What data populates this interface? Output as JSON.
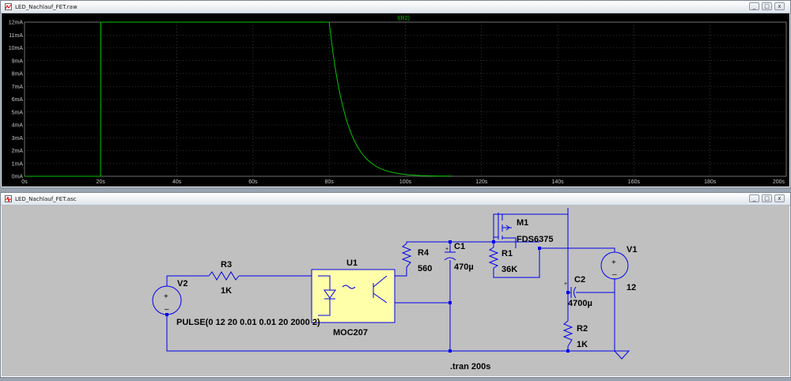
{
  "plot_window": {
    "title": "LED_Nachlauf_FET.raw",
    "trace_name": "I(R2)",
    "trace_color": "#00c400",
    "y_ticks": [
      "12mA",
      "11mA",
      "10mA",
      "9mA",
      "8mA",
      "7mA",
      "6mA",
      "5mA",
      "4mA",
      "3mA",
      "2mA",
      "1mA",
      "0mA"
    ],
    "x_ticks": [
      "0s",
      "20s",
      "40s",
      "60s",
      "80s",
      "100s",
      "120s",
      "140s",
      "160s",
      "180s",
      "200s"
    ]
  },
  "schematic_window": {
    "title": "LED_Nachlauf_FET.asc",
    "wire_color": "#0000ee",
    "components": {
      "v2_name": "V2",
      "v2_value": "PULSE(0 12 20 0.01 0.01 20 2000 2)",
      "r3_name": "R3",
      "r3_value": "1K",
      "u1_name": "U1",
      "u1_value": "MOC207",
      "r4_name": "R4",
      "r4_value": "560",
      "c1_name": "C1",
      "c1_value": "470µ",
      "m1_name": "M1",
      "m1_value": "FDS6375",
      "r1_name": "R1",
      "r1_value": "36K",
      "v1_name": "V1",
      "v1_value": "12",
      "c2_name": "C2",
      "c2_value": "4700µ",
      "r2_name": "R2",
      "r2_value": "1K"
    },
    "directive": ".tran 200s"
  },
  "window_controls": {
    "minimize": "_",
    "maximize": "□",
    "close": "x"
  },
  "icons": {
    "app": "ltspice-waveform-icon"
  }
}
